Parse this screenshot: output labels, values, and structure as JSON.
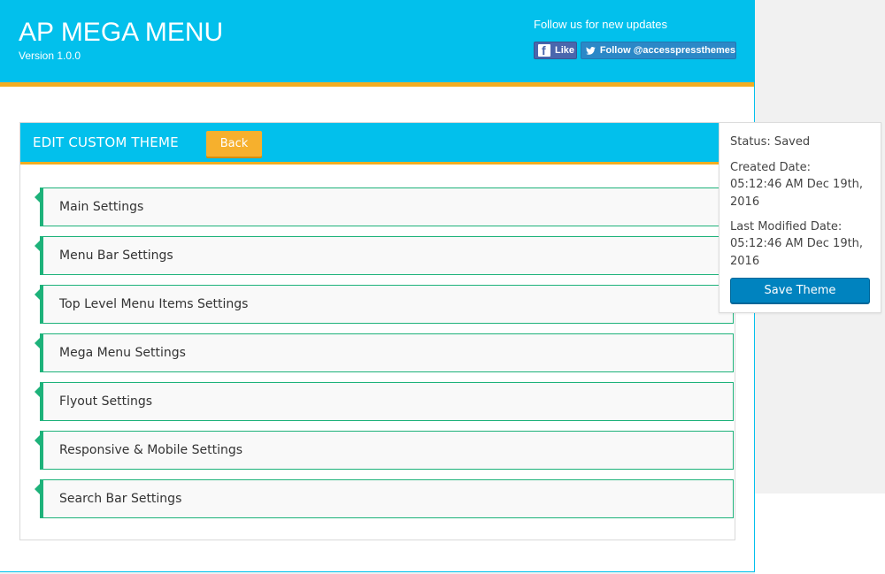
{
  "header": {
    "title": "AP MEGA MENU",
    "version": "Version 1.0.0",
    "follow_text": "Follow us for new updates",
    "facebook_like_label": "Like",
    "twitter_follow_label": "Follow @accesspressthemes"
  },
  "panel": {
    "title": "EDIT CUSTOM THEME",
    "back_label": "Back"
  },
  "settings": [
    {
      "label": "Main Settings"
    },
    {
      "label": "Menu Bar Settings"
    },
    {
      "label": "Top Level Menu Items Settings"
    },
    {
      "label": "Mega Menu Settings"
    },
    {
      "label": "Flyout Settings"
    },
    {
      "label": "Responsive & Mobile Settings"
    },
    {
      "label": "Search Bar Settings"
    }
  ],
  "status_box": {
    "status": "Status: Saved",
    "created_label": "Created Date:",
    "created_value": "05:12:46 AM Dec 19th, 2016",
    "modified_label": "Last Modified Date:",
    "modified_value": "05:12:46 AM Dec 19th, 2016",
    "save_label": "Save Theme"
  },
  "colors": {
    "header_blue": "#02c0ec",
    "accent_orange": "#f3ad22",
    "setting_green": "#1db27a",
    "save_blue": "#0083bf",
    "facebook_blue": "#4a66ad",
    "twitter_blue": "#2b88c7"
  },
  "icons": {
    "facebook": "facebook-icon",
    "twitter": "twitter-bird-icon",
    "setting_marker": "triangle-marker-icon"
  }
}
